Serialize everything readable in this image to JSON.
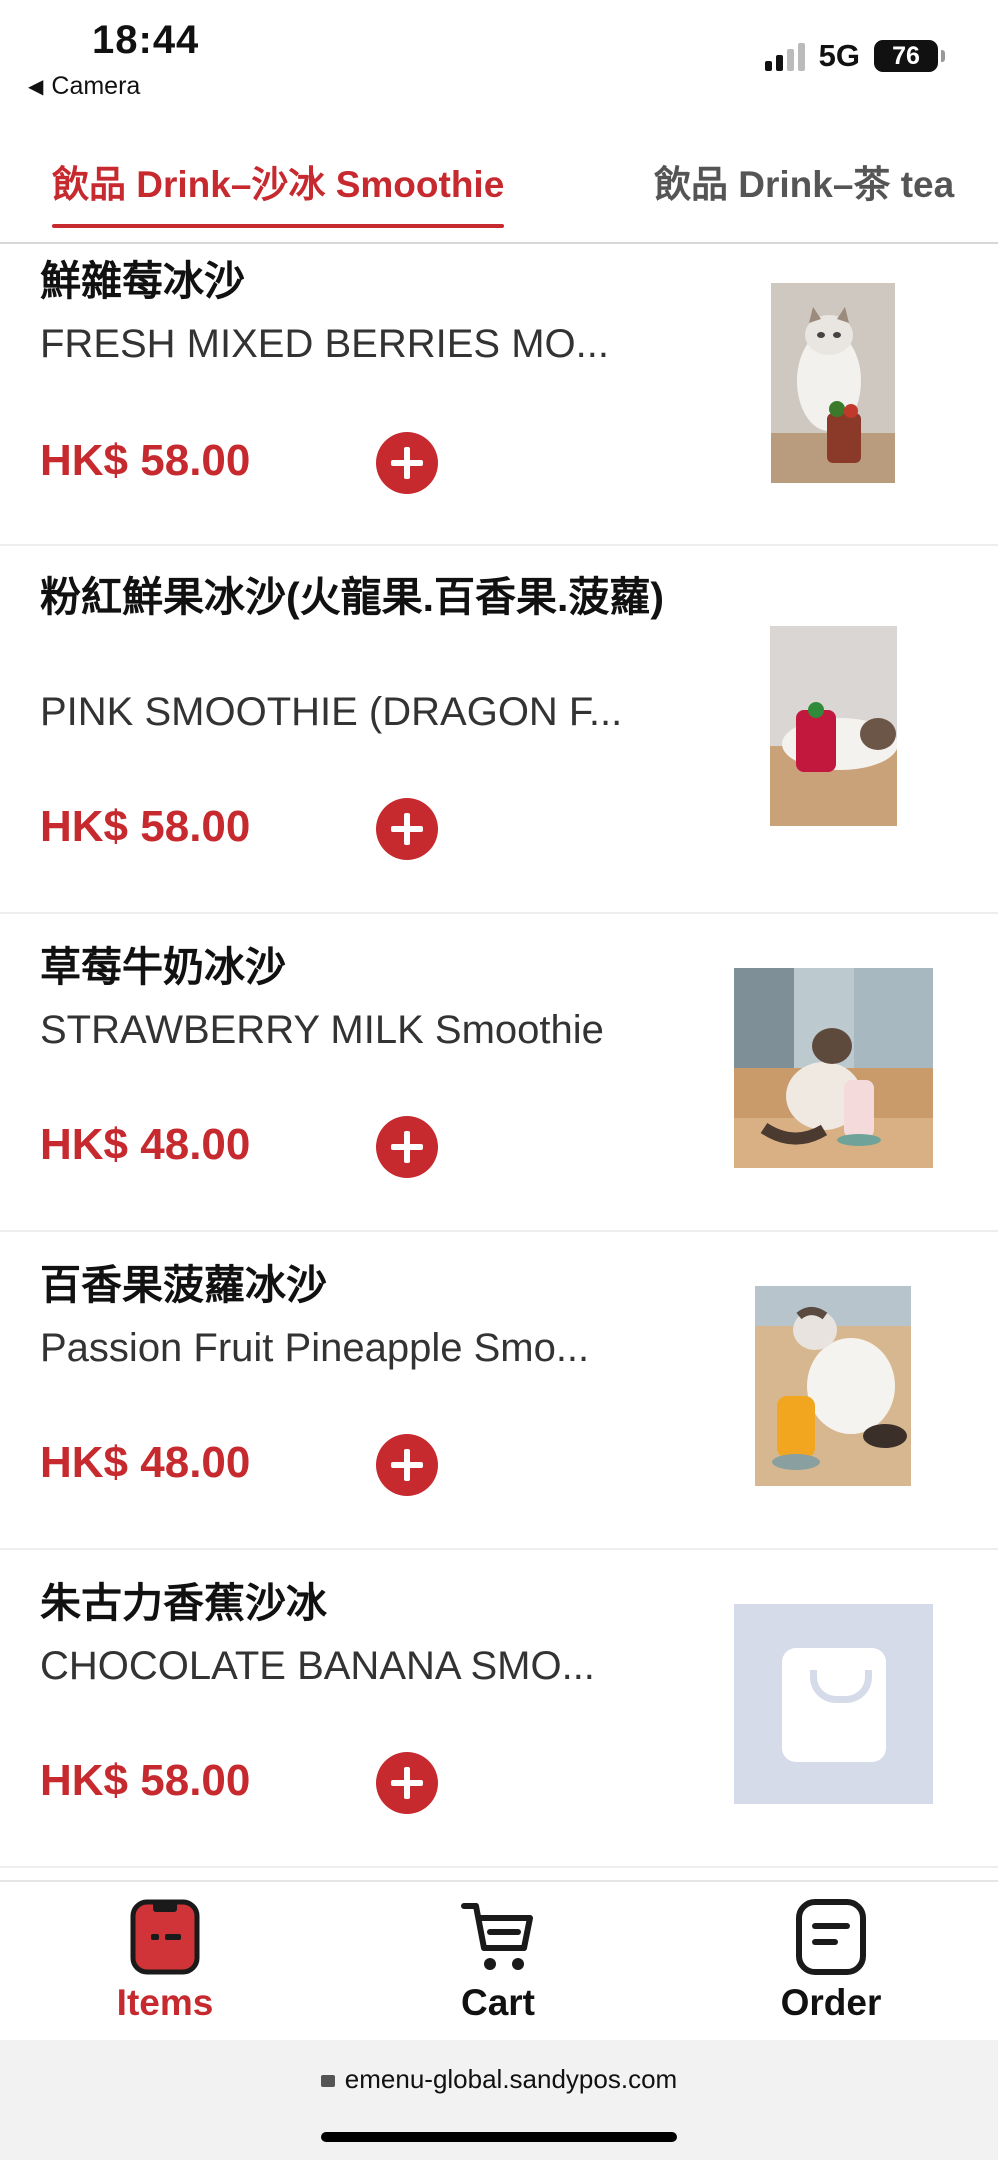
{
  "status_bar": {
    "time": "18:44",
    "back_app": "Camera",
    "network": "5G",
    "battery": "76"
  },
  "tabs": [
    {
      "label": "飲品 Drink–沙冰 Smoothie",
      "active": true
    },
    {
      "label": "飲品 Drink–茶 tea",
      "active": false
    }
  ],
  "items": [
    {
      "name": "鮮雜莓冰沙",
      "desc": "FRESH MIXED BERRIES MO...",
      "price": "HK$ 58.00",
      "image": "cat-with-berry-drink"
    },
    {
      "name": "粉紅鮮果冰沙(火龍果.百香果.菠蘿)",
      "desc": "PINK SMOOTHIE (DRAGON F...",
      "price": "HK$ 58.00",
      "image": "cat-with-pink-drink"
    },
    {
      "name": "草莓牛奶冰沙",
      "desc": "STRAWBERRY MILK Smoothie",
      "price": "HK$ 48.00",
      "image": "cat-by-window-with-drink"
    },
    {
      "name": "百香果菠蘿冰沙",
      "desc": "Passion Fruit Pineapple Smo...",
      "price": "HK$ 48.00",
      "image": "cat-with-yellow-drink"
    },
    {
      "name": "朱古力香蕉沙冰",
      "desc": "CHOCOLATE BANANA SMO...",
      "price": "HK$ 58.00",
      "image": "placeholder-bag-icon"
    }
  ],
  "nav": {
    "items": "Items",
    "cart": "Cart",
    "order": "Order"
  },
  "browser": {
    "url": "emenu-global.sandypos.com"
  },
  "colors": {
    "accent": "#c62a2f",
    "placeholder": "#d6dbe9"
  }
}
